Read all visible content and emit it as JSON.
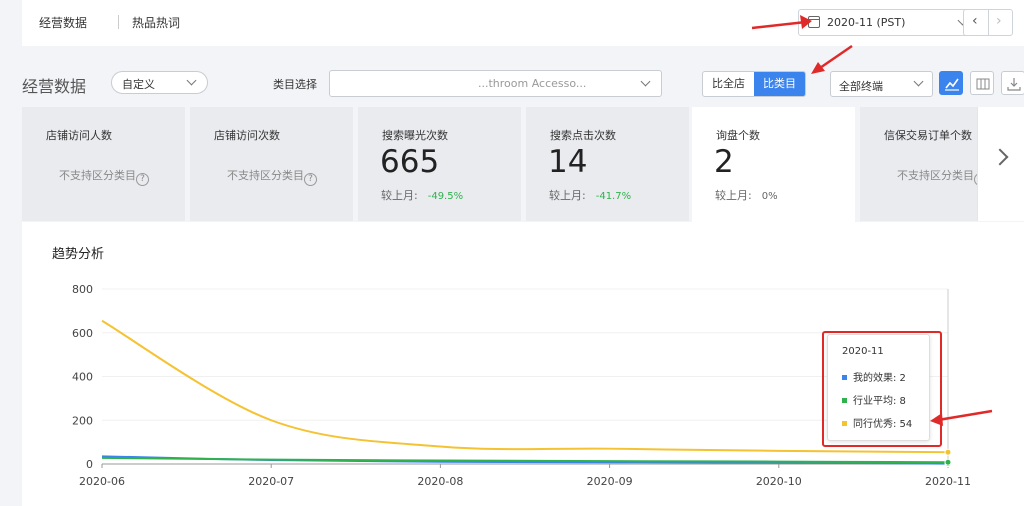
{
  "top": {
    "tab_data": "经营数据",
    "tab_keywords": "热品热词",
    "month_value": "2020-11 (PST)",
    "prev_glyph": "‹",
    "next_glyph": "›"
  },
  "controls": {
    "title": "经营数据",
    "range_value": "自定义",
    "category_label": "类目选择",
    "category_value": "...throom Accesso...",
    "compare_store": "比全店",
    "compare_category": "比类目",
    "terminal_value": "全部终端"
  },
  "cards": [
    {
      "title": "店铺访问人数",
      "na": "不支持区分类目"
    },
    {
      "title": "店铺访问次数",
      "na": "不支持区分类目"
    },
    {
      "title": "搜索曝光次数",
      "value": "665",
      "compare_label": "较上月:",
      "change": "-49.5%"
    },
    {
      "title": "搜索点击次数",
      "value": "14",
      "compare_label": "较上月:",
      "change": "-41.7%"
    },
    {
      "title": "询盘个数",
      "value": "2",
      "compare_label": "较上月:",
      "change": "0%"
    },
    {
      "title": "信保交易订单个数",
      "na": "不支持区分类目"
    }
  ],
  "qmark": "?",
  "chart": {
    "title": "趋势分析"
  },
  "tooltip": {
    "title": "2020-11",
    "rows": [
      {
        "label": "我的效果: 2",
        "color": "#3b83ed"
      },
      {
        "label": "行业平均: 8",
        "color": "#2fb24c"
      },
      {
        "label": "同行优秀: 54",
        "color": "#f5c231"
      }
    ]
  },
  "colors": {
    "accent": "#3b83ed",
    "annotation": "#e02a2a"
  },
  "chart_data": {
    "type": "line",
    "x": [
      "2020-06",
      "2020-07",
      "2020-08",
      "2020-09",
      "2020-10",
      "2020-11"
    ],
    "ylim": [
      0,
      800
    ],
    "yticks": [
      0,
      200,
      400,
      600,
      800
    ],
    "series": [
      {
        "name": "我的效果",
        "color": "#3b83ed",
        "values": [
          35,
          18,
          10,
          8,
          6,
          2
        ]
      },
      {
        "name": "行业平均",
        "color": "#2fb24c",
        "values": [
          28,
          20,
          16,
          13,
          11,
          8
        ]
      },
      {
        "name": "同行优秀",
        "color": "#f5c231",
        "values": [
          655,
          200,
          80,
          70,
          60,
          54
        ]
      }
    ]
  }
}
